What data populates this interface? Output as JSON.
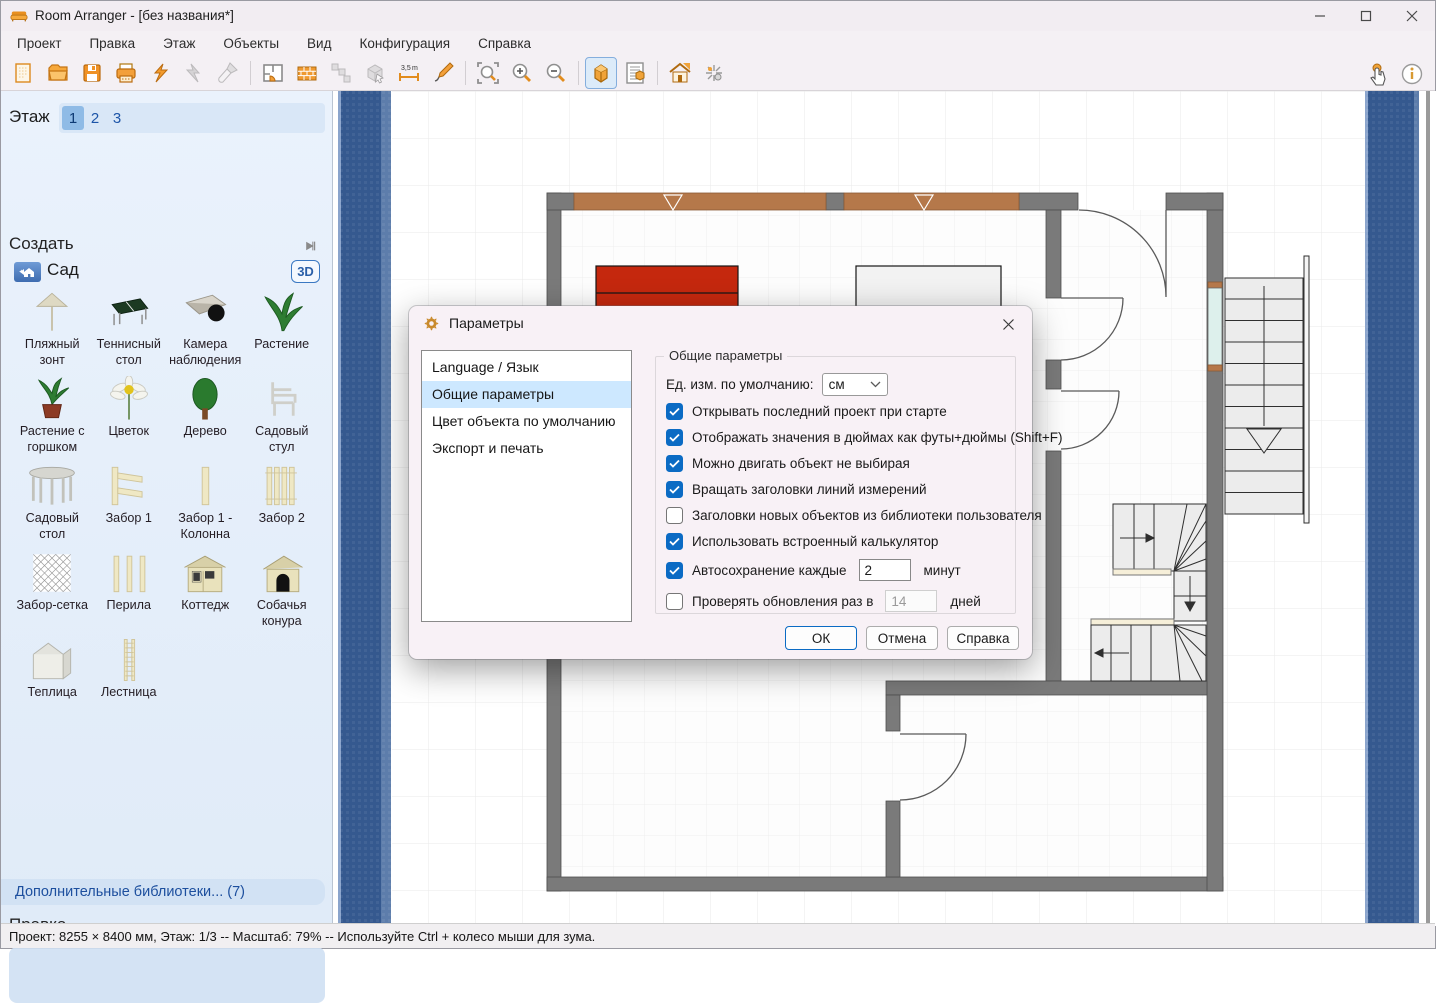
{
  "window": {
    "title": "Room Arranger - [без названия*]"
  },
  "menu": {
    "items": [
      "Проект",
      "Правка",
      "Этаж",
      "Объекты",
      "Вид",
      "Конфигурация",
      "Справка"
    ]
  },
  "toolbar": {
    "buttons": [
      {
        "name": "new-project",
        "icon": "doc"
      },
      {
        "name": "open-project",
        "icon": "folder"
      },
      {
        "name": "save-project",
        "icon": "floppy"
      },
      {
        "name": "print",
        "icon": "printer"
      },
      {
        "name": "undo",
        "icon": "undo"
      },
      {
        "name": "redo",
        "icon": "redo",
        "dim": true
      },
      {
        "name": "format-brush",
        "icon": "brush",
        "dim": true
      },
      {
        "name": "add-room",
        "icon": "room"
      },
      {
        "name": "add-wall",
        "icon": "wall"
      },
      {
        "name": "edit-points",
        "icon": "points",
        "dim": true
      },
      {
        "name": "insert-object",
        "icon": "object",
        "dim": true
      },
      {
        "name": "measure",
        "icon": "measure"
      },
      {
        "name": "draw",
        "icon": "pen"
      },
      {
        "name": "zoom-fit",
        "icon": "zoomfit"
      },
      {
        "name": "zoom-in",
        "icon": "zoomin"
      },
      {
        "name": "zoom-out",
        "icon": "zoomout"
      },
      {
        "name": "view-3d",
        "icon": "view3d",
        "pressed": true
      },
      {
        "name": "report",
        "icon": "report"
      },
      {
        "name": "walkthrough-3d",
        "icon": "house3d"
      },
      {
        "name": "explode-view",
        "icon": "explode"
      }
    ],
    "separators_after": [
      6,
      12,
      15,
      17
    ],
    "right_buttons": [
      {
        "name": "touch-mode",
        "icon": "hand"
      },
      {
        "name": "about",
        "icon": "info"
      }
    ]
  },
  "sidebar": {
    "floor_label": "Этаж",
    "floor_tabs": [
      {
        "label": "1",
        "selected": true
      },
      {
        "label": "2",
        "selected": false
      },
      {
        "label": "3",
        "selected": false
      }
    ],
    "create_header": "Создать",
    "category": {
      "label": "Сад",
      "view3d_label": "3D"
    },
    "library": {
      "items": [
        {
          "label": "Пляжный зонт",
          "icon": "umbrella"
        },
        {
          "label": "Теннисный стол",
          "icon": "tennis"
        },
        {
          "label": "Камера наблюдения",
          "icon": "camera"
        },
        {
          "label": "Растение",
          "icon": "plant"
        },
        {
          "label": "Растение с горшком",
          "icon": "potted"
        },
        {
          "label": "Цветок",
          "icon": "flower"
        },
        {
          "label": "Дерево",
          "icon": "tree"
        },
        {
          "label": "Садовый стул",
          "icon": "chair"
        },
        {
          "label": "Садовый стол",
          "icon": "table"
        },
        {
          "label": "Забор 1",
          "icon": "fence1"
        },
        {
          "label": "Забор 1 - Колонна",
          "icon": "column"
        },
        {
          "label": "Забор 2",
          "icon": "fence2"
        },
        {
          "label": "Забор-сетка",
          "icon": "mesh"
        },
        {
          "label": "Перила",
          "icon": "railing"
        },
        {
          "label": "Коттедж",
          "icon": "cottage"
        },
        {
          "label": "Собачья конура",
          "icon": "doghouse"
        },
        {
          "label": "Теплица",
          "icon": "greenhouse"
        },
        {
          "label": "Лестница",
          "icon": "ladder"
        }
      ]
    },
    "more_libraries_label": "Дополнительные библиотеки... (7)",
    "edit_header": "Правка"
  },
  "dialog": {
    "title": "Параметры",
    "nav": [
      {
        "label": "Language / Язык",
        "selected": false
      },
      {
        "label": "Общие параметры",
        "selected": true
      },
      {
        "label": "Цвет объекта по умолчанию",
        "selected": false
      },
      {
        "label": "Экспорт и печать",
        "selected": false
      }
    ],
    "group_title": "Общие параметры",
    "unit_label": "Ед. изм. по умолчанию:",
    "unit_value": "см",
    "options": [
      {
        "label": "Открывать последний проект при старте",
        "checked": true
      },
      {
        "label": "Отображать значения в дюймах как футы+дюймы (Shift+F)",
        "checked": true
      },
      {
        "label": "Можно двигать объект не выбирая",
        "checked": true
      },
      {
        "label": "Вращать заголовки линий измерений",
        "checked": true
      },
      {
        "label": "Заголовки новых объектов из библиотеки пользователя",
        "checked": false
      },
      {
        "label": "Использовать встроенный калькулятор",
        "checked": true
      },
      {
        "label": "Автосохранение каждые",
        "checked": true,
        "input": "2",
        "suffix": "минут",
        "input_disabled": false
      },
      {
        "label": "Проверять обновления раз в",
        "checked": false,
        "input": "14",
        "suffix": "дней",
        "input_disabled": true
      }
    ],
    "buttons": [
      {
        "label": "ОК",
        "default": true
      },
      {
        "label": "Отмена",
        "default": false
      },
      {
        "label": "Справка",
        "default": false
      }
    ]
  },
  "statusbar": {
    "text": "Проект: 8255 × 8400 мм, Этаж: 1/3 -- Масштаб: 79% -- Используйте Ctrl + колесо мыши для зума."
  },
  "colors": {
    "accent": "#0b6bc4",
    "wall": "#7a7a7a",
    "window_brown": "#b5784a",
    "bed_red": "#c5280e",
    "canvas_blue": "#35598f",
    "selection_blue": "#cde8ff"
  }
}
